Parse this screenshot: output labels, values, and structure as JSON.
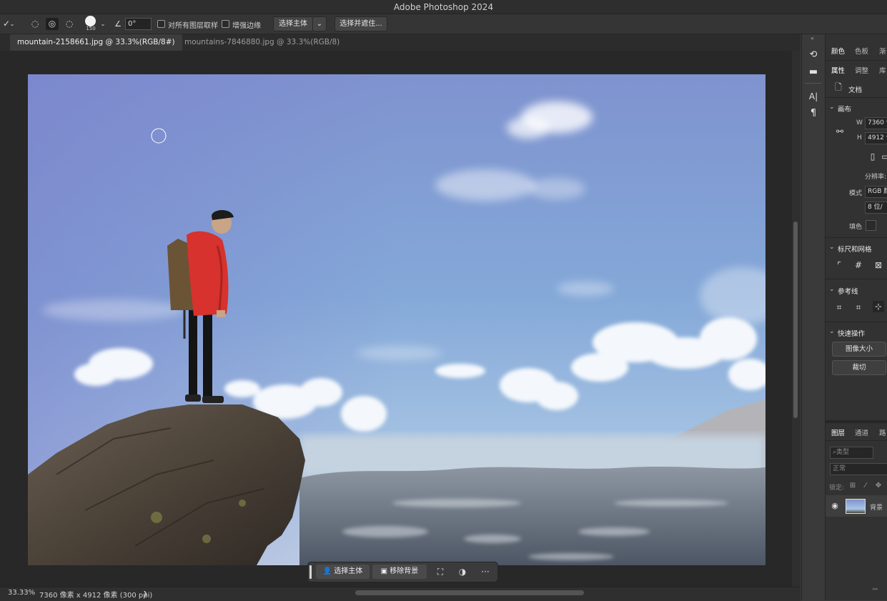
{
  "app": {
    "title": "Adobe Photoshop 2024"
  },
  "options_bar": {
    "brush_size": "150",
    "angle_value": "0°",
    "sample_all_layers_label": "对所有图层取样",
    "enhance_edge_label": "增强边缘",
    "select_subject_label": "选择主体",
    "select_and_mask_label": "选择并遮住..."
  },
  "document_tabs": [
    {
      "label": "mountain-2158661.jpg @ 33.3%(RGB/8#)"
    },
    {
      "label": "mountains-7846880.jpg @ 33.3%(RGB/8)"
    }
  ],
  "status_bar": {
    "zoom": "33.33%",
    "doc_info": "7360 像素 x 4912 像素 (300 ppi)",
    "arrow": "❯"
  },
  "contextual_taskbar": {
    "select_subject_label": "选择主体",
    "remove_background_label": "移除背景",
    "more_label": "···"
  },
  "right_panel": {
    "top_tabs": [
      "颜色",
      "色板",
      "渐"
    ],
    "second_tabs": [
      "属性",
      "调整",
      "库"
    ],
    "doc_label": "文档",
    "canvas_section": "画布",
    "width_label": "W",
    "width_value": "7360 像",
    "height_label": "H",
    "height_value": "4912 像",
    "resolution_label": "分辨率:",
    "mode_label": "模式",
    "mode_value": "RGB 颜",
    "bit_depth_value": "8 位/",
    "fill_label": "填色",
    "rulers_section": "标尺和网格",
    "guides_section": "参考线",
    "quick_actions_section": "快速操作",
    "image_size_button": "图像大小",
    "crop_button": "裁切",
    "layers_tabs": [
      "图层",
      "通道",
      "路"
    ],
    "kind_filter": "类型",
    "blend_mode": "正常",
    "lock_label": "锁定:",
    "layer_name": "背景"
  }
}
